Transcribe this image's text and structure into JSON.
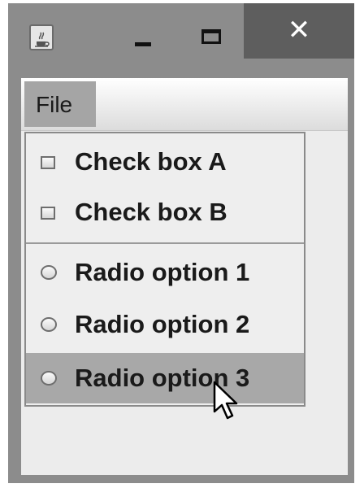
{
  "window": {
    "title_icon": "java-cup-icon",
    "minimize_icon": "minimize-icon",
    "maximize_icon": "maximize-icon",
    "close_glyph": "✕"
  },
  "menubar": {
    "file_label": "File"
  },
  "popup_menu": {
    "checkboxes": [
      {
        "label": "Check box A",
        "checked": false
      },
      {
        "label": "Check box B",
        "checked": false
      }
    ],
    "radios": [
      {
        "label": "Radio option 1",
        "selected": false
      },
      {
        "label": "Radio option 2",
        "selected": false
      },
      {
        "label": "Radio option 3",
        "selected": false,
        "highlighted": true
      }
    ]
  },
  "colors": {
    "highlight": "#a8a8a8",
    "menu_background": "#eeeeee",
    "close_button": "#5e5e5e"
  }
}
